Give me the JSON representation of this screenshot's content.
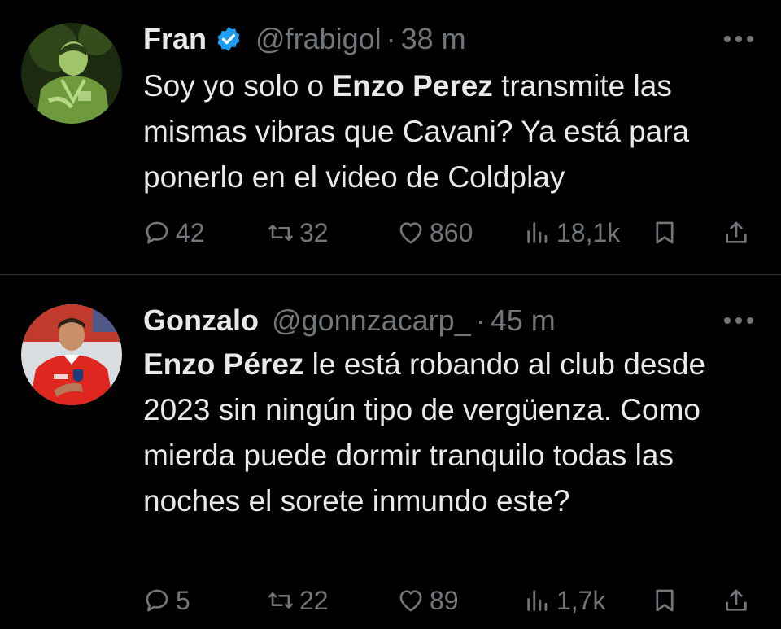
{
  "tweets": [
    {
      "display_name": "Fran",
      "verified": true,
      "handle": "@frabigol",
      "separator": "·",
      "time": "38 m",
      "text_parts": {
        "before": "Soy yo solo o ",
        "bold": "Enzo Perez",
        "after": " transmite las mismas vibras que Cavani? Ya está para ponerlo en el video de Coldplay"
      },
      "stats": {
        "replies": "42",
        "retweets": "32",
        "likes": "860",
        "views": "18,1k"
      },
      "avatar": "avatar-photo-green-tint"
    },
    {
      "display_name": "Gonzalo",
      "verified": false,
      "handle": "@gonnzacarp_",
      "separator": "·",
      "time": "45 m",
      "text_parts": {
        "before": "",
        "bold": "Enzo Pérez",
        "after": " le está robando al club desde 2023 sin ningún tipo de vergüenza. Como mierda puede dormir tranquilo todas las noches el sorete inmundo este?"
      },
      "stats": {
        "replies": "5",
        "retweets": "22",
        "likes": "89",
        "views": "1,7k"
      },
      "avatar": "avatar-photo-red-jersey"
    }
  ],
  "icons": {
    "reply": "reply-icon",
    "retweet": "retweet-icon",
    "like": "heart-icon",
    "views": "views-icon",
    "bookmark": "bookmark-icon",
    "share": "share-icon",
    "more": "more-icon",
    "verified": "verified-badge-icon"
  },
  "colors": {
    "background": "#000000",
    "text": "#e7e9ea",
    "secondary": "#71767b",
    "divider": "#2f3336",
    "verified": "#1d9bf0"
  }
}
